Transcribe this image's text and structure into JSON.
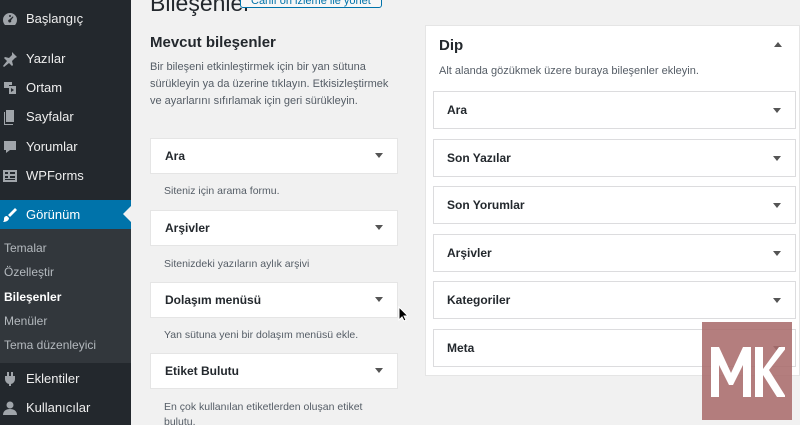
{
  "sidebar": {
    "items": [
      {
        "label": "Başlangıç",
        "icon": "dashboard-icon"
      },
      {
        "label": "Yazılar",
        "icon": "pin-icon"
      },
      {
        "label": "Ortam",
        "icon": "media-icon"
      },
      {
        "label": "Sayfalar",
        "icon": "pages-icon"
      },
      {
        "label": "Yorumlar",
        "icon": "comments-icon"
      },
      {
        "label": "WPForms",
        "icon": "forms-icon"
      },
      {
        "label": "Görünüm",
        "icon": "brush-icon"
      },
      {
        "label": "Eklentiler",
        "icon": "plugin-icon"
      },
      {
        "label": "Kullanıcılar",
        "icon": "user-icon"
      }
    ],
    "submenu": [
      "Temalar",
      "Özelleştir",
      "Bileşenler",
      "Menüler",
      "Tema düzenleyici"
    ]
  },
  "header": {
    "title": "Bileşenler",
    "preview_button": "Canlı ön izleme ile yönet"
  },
  "available": {
    "title": "Mevcut bileşenler",
    "description": "Bir bileşeni etkinleştirmek için bir yan sütuna sürükleyin ya da üzerine tıklayın. Etkisizleştirmek ve ayarlarını sıfırlamak için geri sürükleyin.",
    "widgets": [
      {
        "label": "Ara",
        "description": "Siteniz için arama formu."
      },
      {
        "label": "Arşivler",
        "description": "Sitenizdeki yazıların aylık arşivi"
      },
      {
        "label": "Dolaşım menüsü",
        "description": "Yan sütuna yeni bir dolaşım menüsü ekle."
      },
      {
        "label": "Etiket Bulutu",
        "description": "En çok kullanılan etiketlerden oluşan etiket bulutu."
      }
    ]
  },
  "footer_area": {
    "title": "Dip",
    "description": "Alt alanda gözükmek üzere buraya bileşenler ekleyin.",
    "widgets": [
      "Ara",
      "Son Yazılar",
      "Son Yorumlar",
      "Arşivler",
      "Kategoriler",
      "Meta"
    ]
  },
  "colors": {
    "sidebar_bg": "#23282d",
    "active_bg": "#0073aa",
    "watermark": "#aa6c6c"
  }
}
